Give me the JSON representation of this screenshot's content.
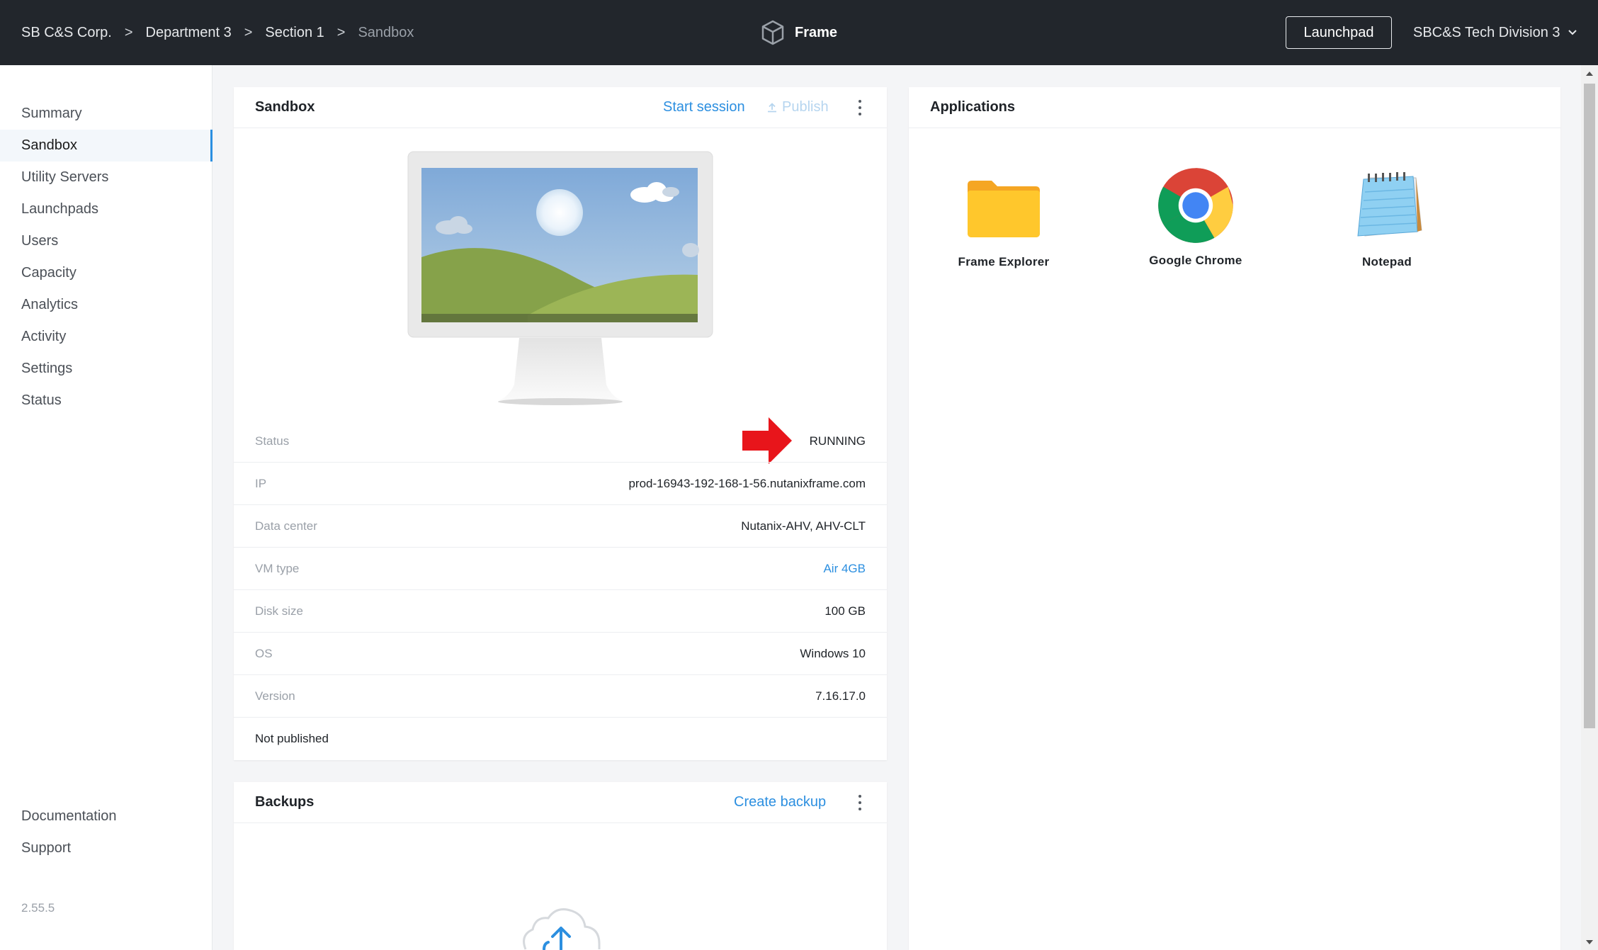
{
  "breadcrumb": {
    "items": [
      "SB C&S Corp.",
      "Department 3",
      "Section 1",
      "Sandbox"
    ],
    "separator": ">"
  },
  "brand": {
    "name": "Frame",
    "icon": "cube-icon"
  },
  "header": {
    "launchpad_label": "Launchpad",
    "org_label": "SBC&S Tech Division 3"
  },
  "sidebar": {
    "items": [
      {
        "label": "Summary"
      },
      {
        "label": "Sandbox",
        "active": true
      },
      {
        "label": "Utility Servers"
      },
      {
        "label": "Launchpads"
      },
      {
        "label": "Users"
      },
      {
        "label": "Capacity"
      },
      {
        "label": "Analytics"
      },
      {
        "label": "Activity"
      },
      {
        "label": "Settings"
      },
      {
        "label": "Status"
      }
    ],
    "footer_items": [
      {
        "label": "Documentation"
      },
      {
        "label": "Support"
      }
    ],
    "version": "2.55.5"
  },
  "sandbox": {
    "title": "Sandbox",
    "start_session_label": "Start session",
    "publish_label": "Publish",
    "details": [
      {
        "label": "Status",
        "value": "RUNNING"
      },
      {
        "label": "IP",
        "value": "prod-16943-192-168-1-56.nutanixframe.com"
      },
      {
        "label": "Data center",
        "value": "Nutanix-AHV, AHV-CLT"
      },
      {
        "label": "VM type",
        "value": "Air 4GB"
      },
      {
        "label": "Disk size",
        "value": "100 GB"
      },
      {
        "label": "OS",
        "value": "Windows 10"
      },
      {
        "label": "Version",
        "value": "7.16.17.0"
      }
    ],
    "publish_status": "Not published"
  },
  "backups": {
    "title": "Backups",
    "create_label": "Create backup"
  },
  "applications": {
    "title": "Applications",
    "items": [
      {
        "label": "Frame Explorer",
        "icon": "folder-icon"
      },
      {
        "label": "Google Chrome",
        "icon": "chrome-icon"
      },
      {
        "label": "Notepad",
        "icon": "notepad-icon"
      }
    ]
  },
  "colors": {
    "topbar": "#22262c",
    "accent": "#2c8fe0",
    "annotation_arrow": "#e8151b"
  }
}
